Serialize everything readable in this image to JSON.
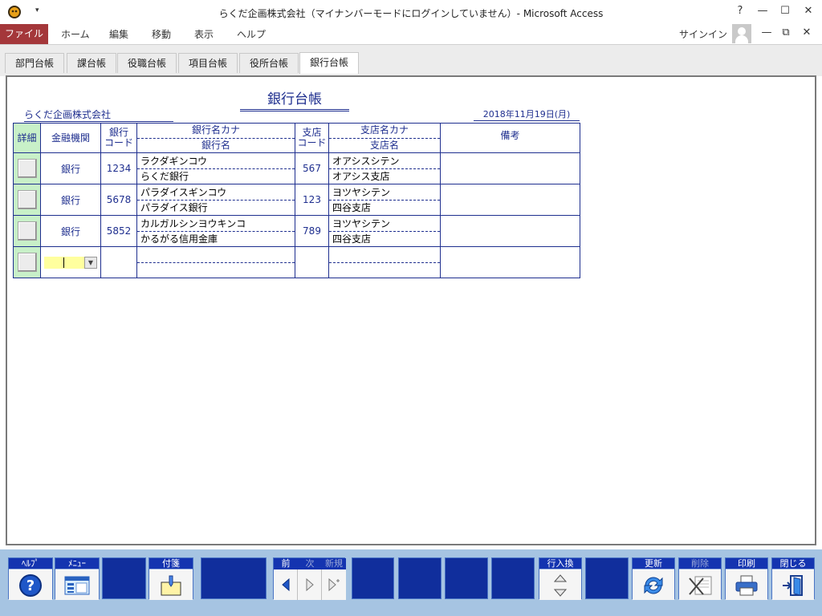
{
  "window": {
    "title": "らくだ企画株式会社（マイナンバーモードにログインしていません）- Microsoft Access",
    "help": "?",
    "minimize": "—",
    "maximize": "☐",
    "close": "✕"
  },
  "ribbon": {
    "file": "ファイル",
    "tabs": [
      "ホーム",
      "編集",
      "移動",
      "表示",
      "ヘルプ"
    ],
    "signin": "サインイン",
    "restore_min": "—",
    "restore": "⧉",
    "ribbon_close": "✕"
  },
  "doc_tabs": [
    "部門台帳",
    "課台帳",
    "役職台帳",
    "項目台帳",
    "役所台帳",
    "銀行台帳"
  ],
  "form": {
    "title": "銀行台帳",
    "company": "らくだ企画株式会社",
    "date": "2018年11月19日(月)",
    "headers": {
      "detail": "詳細",
      "institution": "金融機関",
      "bank_code_1": "銀行",
      "bank_code_2": "コード",
      "bank_kana": "銀行名カナ",
      "bank_name": "銀行名",
      "branch_code_1": "支店",
      "branch_code_2": "コード",
      "branch_kana": "支店名カナ",
      "branch_name": "支店名",
      "remarks": "備考"
    },
    "rows": [
      {
        "institution": "銀行",
        "bank_code": "1234",
        "bank_kana": "ラクダギンコウ",
        "bank_name": "らくだ銀行",
        "branch_code": "567",
        "branch_kana": "オアシスシテン",
        "branch_name": "オアシス支店",
        "remarks": ""
      },
      {
        "institution": "銀行",
        "bank_code": "5678",
        "bank_kana": "パラダイスギンコウ",
        "bank_name": "パラダイス銀行",
        "branch_code": "123",
        "branch_kana": "ヨツヤシテン",
        "branch_name": "四谷支店",
        "remarks": ""
      },
      {
        "institution": "銀行",
        "bank_code": "5852",
        "bank_kana": "カルガルシンヨウキンコ",
        "bank_name": "かるがる信用金庫",
        "branch_code": "789",
        "branch_kana": "ヨツヤシテン",
        "branch_name": "四谷支店",
        "remarks": ""
      }
    ]
  },
  "commands": {
    "help": "ﾍﾙﾌﾟ",
    "menu": "ﾒﾆｭｰ",
    "sticky": "付箋",
    "prev": "前",
    "next": "次",
    "new": "新規",
    "row_swap": "行入換",
    "refresh": "更新",
    "delete": "削除",
    "print": "印刷",
    "close": "閉じる"
  },
  "colors": {
    "file_tab": "#a4373a",
    "form_blue": "#1f2f8f",
    "command_bar": "#a6c4e2",
    "button_blue": "#102e9c",
    "combo_active": "#ffff9e",
    "detail_green": "#c8f0c8"
  }
}
